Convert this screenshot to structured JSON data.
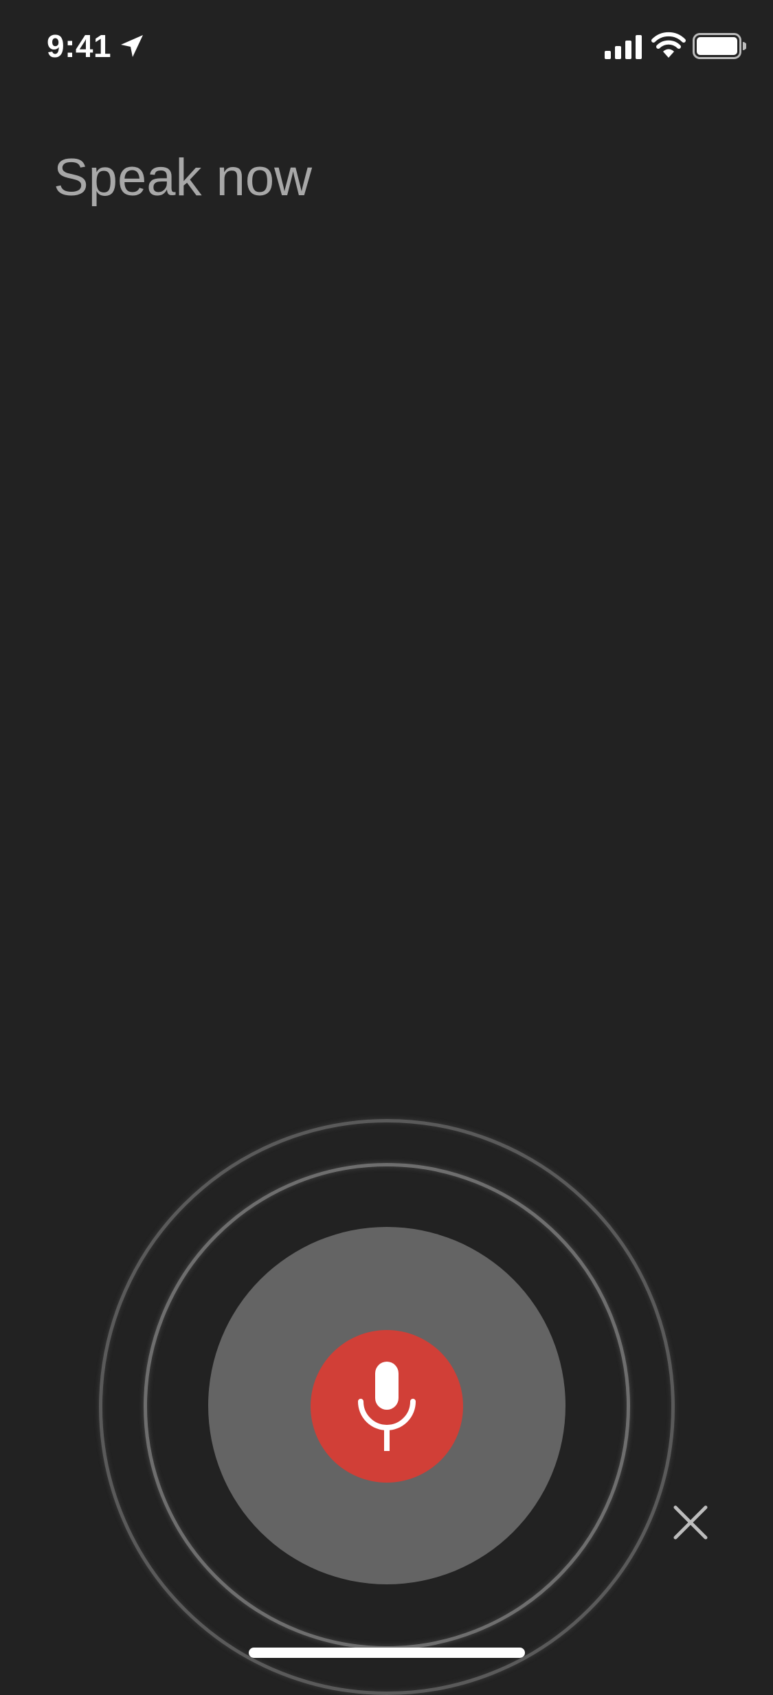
{
  "status_bar": {
    "time": "9:41",
    "icons": [
      "location-arrow-icon",
      "cellular-signal-icon",
      "wifi-icon",
      "battery-icon"
    ]
  },
  "prompt": {
    "text": "Speak now"
  },
  "voice_input": {
    "mic_icon": "microphone-icon",
    "close_icon": "close-icon"
  },
  "colors": {
    "background": "#222222",
    "prompt_text": "#a8a8a8",
    "mic_accent": "#d13f37",
    "level_disc": "#646464",
    "ring": "#6e6e6e"
  }
}
